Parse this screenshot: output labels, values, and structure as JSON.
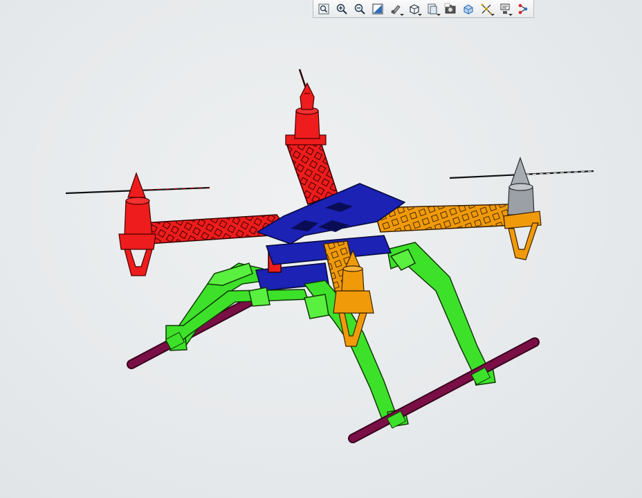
{
  "viewport": {
    "name": "3D model view",
    "background_color": "#e9ecee"
  },
  "toolbar": {
    "buttons": [
      {
        "id": "zoom-fit",
        "icon": "zoom-fit-icon",
        "has_menu": false
      },
      {
        "id": "zoom-in",
        "icon": "zoom-in-icon",
        "has_menu": false
      },
      {
        "id": "zoom-out",
        "icon": "zoom-out-icon",
        "has_menu": false
      },
      {
        "id": "zoom-area",
        "icon": "zoom-area-icon",
        "has_menu": false
      },
      {
        "id": "display-style",
        "icon": "display-style-icon",
        "has_menu": true
      },
      {
        "id": "view-orientation",
        "icon": "view-cube-icon",
        "has_menu": true
      },
      {
        "id": "section-view",
        "icon": "section-view-icon",
        "has_menu": true
      },
      {
        "id": "capture",
        "icon": "camera-icon",
        "has_menu": false
      },
      {
        "id": "model-tree",
        "icon": "model-3d-icon",
        "has_menu": false
      },
      {
        "id": "explode",
        "icon": "explode-icon",
        "has_menu": true
      },
      {
        "id": "annotations",
        "icon": "annotation-icon",
        "has_menu": true
      },
      {
        "id": "network",
        "icon": "network-icon",
        "has_menu": false
      }
    ]
  },
  "model": {
    "parts": [
      {
        "name": "front-left-arm",
        "color": "#ee1c1c"
      },
      {
        "name": "back-arm",
        "color": "#ee1c1c"
      },
      {
        "name": "front-right-arm",
        "color": "#f09a0a"
      },
      {
        "name": "rear-right-arm",
        "color": "#f09a0a"
      },
      {
        "name": "center-plates",
        "color": "#1b22b4"
      },
      {
        "name": "landing-gear",
        "color": "#3ee12a"
      },
      {
        "name": "landing-skids",
        "color": "#7a0f45"
      },
      {
        "name": "motor-grey",
        "color": "#a7acb2"
      }
    ]
  }
}
